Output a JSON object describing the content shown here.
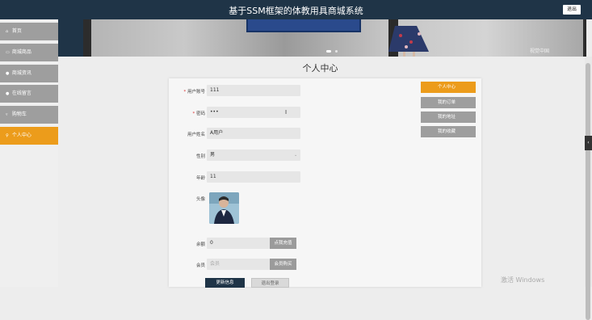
{
  "header": {
    "title": "基于SSM框架的体教用具商城系统",
    "logout_label": "退出"
  },
  "sidebar": {
    "items": [
      {
        "icon": "⌂",
        "label": "首页",
        "active": false
      },
      {
        "icon": "▭",
        "label": "商城商品",
        "active": false
      },
      {
        "icon": "●",
        "label": "商城资讯",
        "active": false
      },
      {
        "icon": "●",
        "label": "在线留言",
        "active": false
      },
      {
        "icon": "▿",
        "label": "购物车",
        "active": false
      },
      {
        "icon": "♀",
        "label": "个人中心",
        "active": true
      }
    ]
  },
  "banner": {
    "watermark": "视觉中国"
  },
  "page": {
    "title": "个人中心"
  },
  "form": {
    "username_label": "用户账号",
    "username_value": "111",
    "password_label": "密码",
    "password_value": "•••",
    "name_label": "用户姓名",
    "name_value": "A用户",
    "gender_label": "性别",
    "gender_value": "男",
    "age_label": "年龄",
    "age_value": "11",
    "avatar_label": "头像",
    "balance_label": "余额",
    "balance_value": "0",
    "recharge_label": "点我充值",
    "member_label": "会员",
    "member_placeholder": "会员",
    "buy_member_label": "会员购买",
    "update_label": "更新信息",
    "logout_label": "退出登录"
  },
  "tabs": [
    {
      "label": "个人中心",
      "active": true
    },
    {
      "label": "我的订单",
      "active": false
    },
    {
      "label": "我的地址",
      "active": false
    },
    {
      "label": "我的收藏",
      "active": false
    }
  ],
  "os": {
    "activate_text": "激活 Windows"
  },
  "colors": {
    "accent": "#ec9c1b",
    "header": "#1f3447",
    "nav": "#9e9e9e"
  }
}
